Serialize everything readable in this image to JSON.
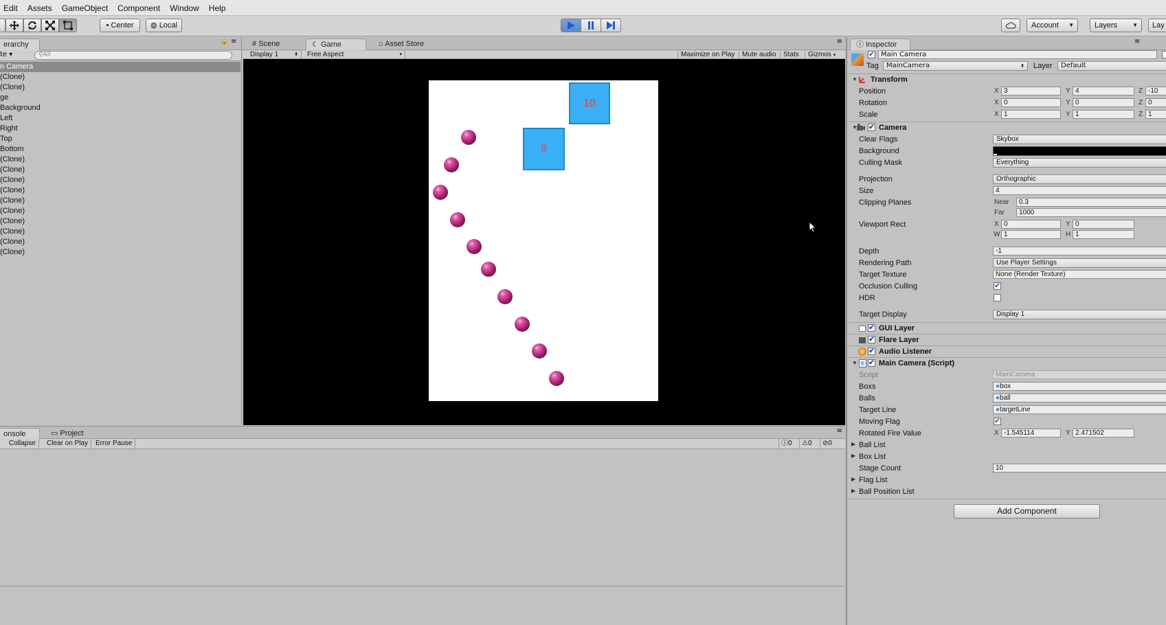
{
  "menu": [
    "Edit",
    "Assets",
    "GameObject",
    "Component",
    "Window",
    "Help"
  ],
  "toolbar": {
    "pivot_label": "Center",
    "space_label": "Local",
    "account_label": "Account",
    "layers_label": "Layers",
    "layout_label": "Lay"
  },
  "hierarchy": {
    "tab_label": "erarchy",
    "create_label": "te",
    "search_placeholder": "All",
    "items": [
      "n Camera",
      "(Clone)",
      "(Clone)",
      "ge",
      "Background",
      "Left",
      "Right",
      "Top",
      "Bottom",
      "(Clone)",
      "(Clone)",
      "(Clone)",
      "(Clone)",
      "(Clone)",
      "(Clone)",
      "(Clone)",
      "(Clone)",
      "(Clone)",
      "(Clone)"
    ],
    "selected_index": 0
  },
  "center_tabs": {
    "scene": "Scene",
    "game": "Game",
    "asset_store": "Asset Store"
  },
  "game_bar": {
    "display": "Display 1",
    "aspect": "Free Aspect",
    "maximize": "Maximize on Play",
    "mute": "Mute audio",
    "stats": "Stats",
    "gizmos": "Gizmos"
  },
  "game_view": {
    "boxes": [
      {
        "label": "10",
        "color": "#3ab0f5"
      },
      {
        "label": "9",
        "color": "#3ab0f5"
      }
    ],
    "ball_count": 10,
    "ball_color": "#a0206a"
  },
  "console": {
    "tab_console": "onsole",
    "tab_project": "Project",
    "clear_label": "",
    "collapse_label": "Collapse",
    "clear_on_play_label": "Clear on Play",
    "error_pause_label": "Error Pause",
    "info_count": "0",
    "warn_count": "0",
    "error_count": "0"
  },
  "inspector": {
    "tab_label": "Inspector",
    "object_name": "Main Camera",
    "tag_label": "Tag",
    "tag_value": "MainCamera",
    "layer_label": "Layer",
    "layer_value": "Default",
    "transform": {
      "title": "Transform",
      "position_label": "Position",
      "position": {
        "x": "3",
        "y": "4",
        "z": "-10"
      },
      "rotation_label": "Rotation",
      "rotation": {
        "x": "0",
        "y": "0",
        "z": "0"
      },
      "scale_label": "Scale",
      "scale": {
        "x": "1",
        "y": "1",
        "z": "1"
      }
    },
    "camera": {
      "title": "Camera",
      "clear_flags_label": "Clear Flags",
      "clear_flags": "Skybox",
      "background_label": "Background",
      "background_color": "#000000",
      "culling_mask_label": "Culling Mask",
      "culling_mask": "Everything",
      "projection_label": "Projection",
      "projection": "Orthographic",
      "size_label": "Size",
      "size": "4",
      "clipping_label": "Clipping Planes",
      "near_label": "Near",
      "near": "0.3",
      "far_label": "Far",
      "far": "1000",
      "viewport_label": "Viewport Rect",
      "vx": "0",
      "vy": "0",
      "vw": "1",
      "vh": "1",
      "depth_label": "Depth",
      "depth": "-1",
      "rendering_path_label": "Rendering Path",
      "rendering_path": "Use Player Settings",
      "target_texture_label": "Target Texture",
      "target_texture": "None (Render Texture)",
      "occlusion_label": "Occlusion Culling",
      "occlusion": true,
      "hdr_label": "HDR",
      "hdr": false,
      "target_display_label": "Target Display",
      "target_display": "Display 1"
    },
    "gui_layer": "GUI Layer",
    "flare_layer": "Flare Layer",
    "audio_listener": "Audio Listener",
    "script": {
      "title": "Main Camera (Script)",
      "script_label": "Script",
      "script_value": "MainCamera",
      "boxs_label": "Boxs",
      "boxs_value": "box",
      "balls_label": "Balls",
      "balls_value": "ball",
      "target_line_label": "Target Line",
      "target_line_value": "targetLine",
      "moving_flag_label": "Moving Flag",
      "moving_flag": true,
      "rotated_label": "Rotated Fire Value",
      "rx": "-1.545114",
      "ry": "2.471502",
      "ball_list_label": "Ball List",
      "box_list_label": "Box List",
      "stage_count_label": "Stage Count",
      "stage_count": "10",
      "flag_list_label": "Flag List",
      "ball_position_label": "Ball Position List"
    },
    "add_component": "Add Component"
  }
}
